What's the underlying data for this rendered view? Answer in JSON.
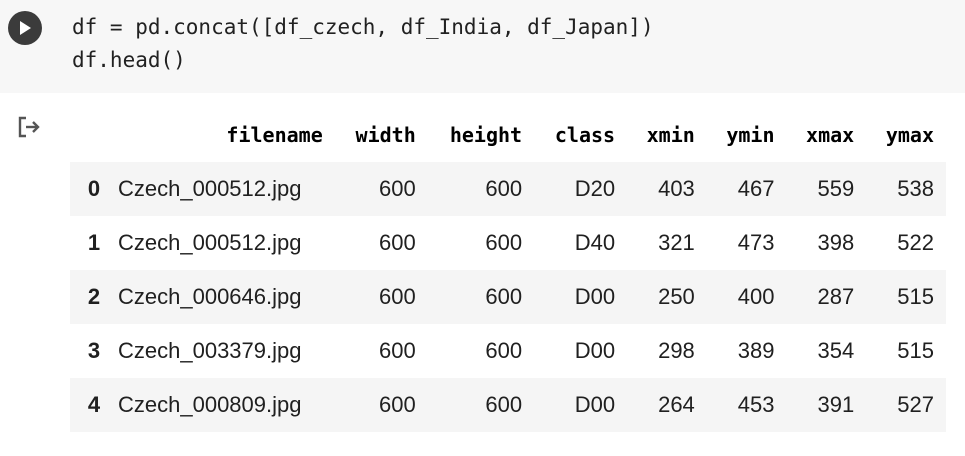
{
  "code": {
    "lines": [
      "df = pd.concat([df_czech, df_India, df_Japan])",
      "df.head()"
    ]
  },
  "table": {
    "columns": [
      "",
      "filename",
      "width",
      "height",
      "class",
      "xmin",
      "ymin",
      "xmax",
      "ymax"
    ],
    "rows": [
      {
        "index": "0",
        "filename": "Czech_000512.jpg",
        "width": "600",
        "height": "600",
        "class": "D20",
        "xmin": "403",
        "ymin": "467",
        "xmax": "559",
        "ymax": "538"
      },
      {
        "index": "1",
        "filename": "Czech_000512.jpg",
        "width": "600",
        "height": "600",
        "class": "D40",
        "xmin": "321",
        "ymin": "473",
        "xmax": "398",
        "ymax": "522"
      },
      {
        "index": "2",
        "filename": "Czech_000646.jpg",
        "width": "600",
        "height": "600",
        "class": "D00",
        "xmin": "250",
        "ymin": "400",
        "xmax": "287",
        "ymax": "515"
      },
      {
        "index": "3",
        "filename": "Czech_003379.jpg",
        "width": "600",
        "height": "600",
        "class": "D00",
        "xmin": "298",
        "ymin": "389",
        "xmax": "354",
        "ymax": "515"
      },
      {
        "index": "4",
        "filename": "Czech_000809.jpg",
        "width": "600",
        "height": "600",
        "class": "D00",
        "xmin": "264",
        "ymin": "453",
        "xmax": "391",
        "ymax": "527"
      }
    ]
  },
  "icons": {
    "run": "play-icon",
    "output": "output-arrow-icon"
  },
  "colors": {
    "code_background": "#f7f7f7",
    "run_button": "#3b3b3b",
    "row_stripe": "#f5f5f5"
  }
}
